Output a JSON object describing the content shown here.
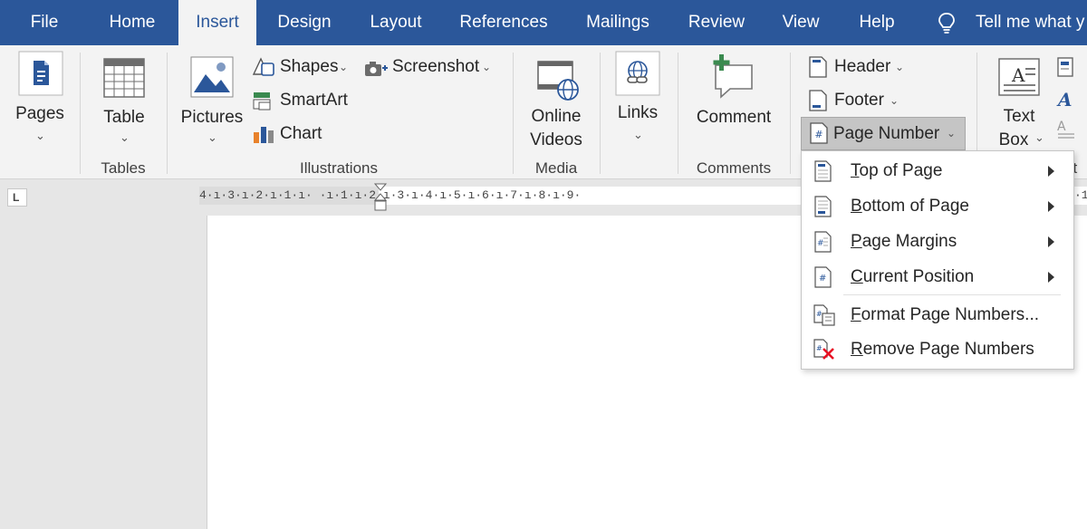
{
  "tabs": [
    {
      "label": "File",
      "active": false
    },
    {
      "label": "Home",
      "active": false
    },
    {
      "label": "Insert",
      "active": true
    },
    {
      "label": "Design",
      "active": false
    },
    {
      "label": "Layout",
      "active": false
    },
    {
      "label": "References",
      "active": false
    },
    {
      "label": "Mailings",
      "active": false
    },
    {
      "label": "Review",
      "active": false
    },
    {
      "label": "View",
      "active": false
    },
    {
      "label": "Help",
      "active": false
    }
  ],
  "tell_me": {
    "text": "Tell me what y",
    "icon": "lightbulb-icon"
  },
  "ribbon": {
    "pages": {
      "label": "Pages",
      "icon": "pages-icon"
    },
    "tables": {
      "label": "Table",
      "icon": "table-icon",
      "group": "Tables"
    },
    "illustrations": {
      "group": "Illustrations",
      "pictures": {
        "label": "Pictures",
        "icon": "pictures-icon"
      },
      "shapes": {
        "label": "Shapes",
        "icon": "shapes-icon"
      },
      "smartart": {
        "label": "SmartArt",
        "icon": "smartart-icon"
      },
      "chart": {
        "label": "Chart",
        "icon": "chart-icon"
      },
      "screenshot": {
        "label": "Screenshot",
        "icon": "screenshot-icon"
      }
    },
    "media": {
      "group": "Media",
      "label_line1": "Online",
      "label_line2": "Videos",
      "icon": "online-video-icon"
    },
    "links": {
      "label": "Links",
      "icon": "links-icon"
    },
    "comments": {
      "group": "Comments",
      "label": "Comment",
      "icon": "comment-icon"
    },
    "header_footer": {
      "header": {
        "label": "Header",
        "icon": "header-icon"
      },
      "footer": {
        "label": "Footer",
        "icon": "footer-icon"
      },
      "page_number": {
        "label": "Page Number",
        "icon": "page-number-icon"
      }
    },
    "text": {
      "label_line1": "Text",
      "label_line2": "Box",
      "group_partial": "xt",
      "icon": "text-box-icon"
    }
  },
  "ruler": {
    "text": "4·ı·3·ı·2·ı·1·ı·  ·ı·1·ı·2·ı·3·ı·4·ı·5·ı·6·ı·7·ı·8·ı·9·",
    "tail": "·1",
    "corner": "L"
  },
  "menu": {
    "items": [
      {
        "label": "Top of Page",
        "key": "T",
        "rest": "op of Page",
        "submenu": true,
        "icon": "top-of-page-icon"
      },
      {
        "label": "Bottom of Page",
        "key": "B",
        "rest": "ottom of Page",
        "submenu": true,
        "icon": "bottom-of-page-icon"
      },
      {
        "label": "Page Margins",
        "key": "P",
        "rest": "age Margins",
        "submenu": true,
        "icon": "page-margins-icon"
      },
      {
        "label": "Current Position",
        "key": "C",
        "rest": "urrent Position",
        "submenu": true,
        "icon": "current-position-icon"
      },
      {
        "label": "Format Page Numbers...",
        "key": "F",
        "rest": "ormat Page Numbers...",
        "submenu": false,
        "icon": "format-page-numbers-icon"
      },
      {
        "label": "Remove Page Numbers",
        "key": "R",
        "rest": "emove Page Numbers",
        "submenu": false,
        "icon": "remove-page-numbers-icon"
      }
    ]
  },
  "colors": {
    "accent": "#2b579a",
    "ribbon_bg": "#f3f3f3",
    "doc_bg": "#e6e6e6",
    "remove_red": "#e81123",
    "chart_orange": "#e8822b"
  }
}
